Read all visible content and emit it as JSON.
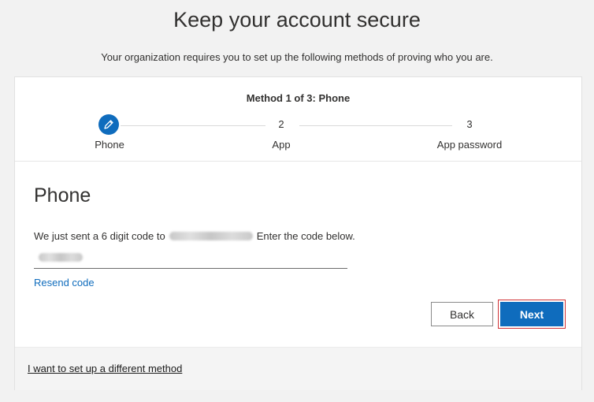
{
  "page": {
    "title": "Keep your account secure",
    "subtitle": "Your organization requires you to set up the following methods of proving who you are."
  },
  "progress": {
    "title": "Method 1 of 3: Phone",
    "steps": [
      {
        "number": "1",
        "label": "Phone",
        "state": "current",
        "icon": "pencil-icon"
      },
      {
        "number": "2",
        "label": "App",
        "state": "upcoming"
      },
      {
        "number": "3",
        "label": "App password",
        "state": "upcoming"
      }
    ]
  },
  "section": {
    "heading": "Phone",
    "instruction_before": "We just sent a 6 digit code to",
    "instruction_after": "Enter the code below.",
    "resend_label": "Resend code"
  },
  "buttons": {
    "back_label": "Back",
    "next_label": "Next"
  },
  "footer": {
    "alt_method_label": "I want to set up a different method"
  },
  "colors": {
    "accent": "#0f6cbd",
    "focus_outline": "#d13438",
    "background": "#f2f2f2"
  }
}
